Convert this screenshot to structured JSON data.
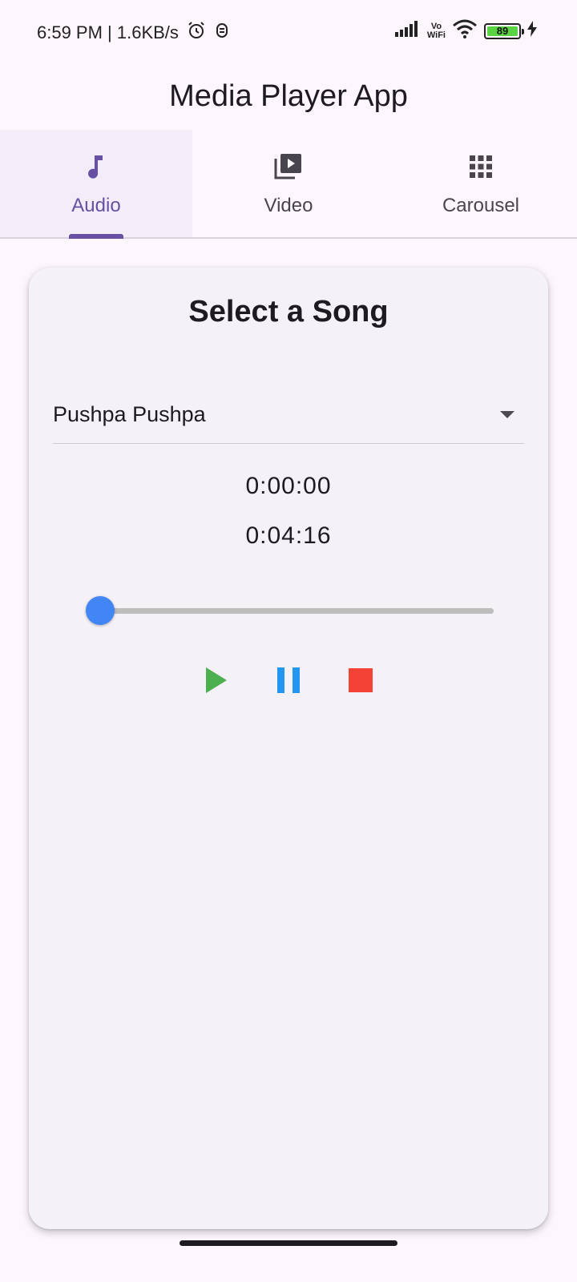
{
  "status_bar": {
    "time_speed": "6:59 PM | 1.6KB/s",
    "vowifi_top": "Vo",
    "vowifi_bottom": "WiFi",
    "battery_level": "89"
  },
  "app_bar": {
    "title": "Media Player App"
  },
  "tabs": [
    {
      "label": "Audio",
      "icon": "music-note-icon",
      "active": true
    },
    {
      "label": "Video",
      "icon": "video-library-icon",
      "active": false
    },
    {
      "label": "Carousel",
      "icon": "apps-grid-icon",
      "active": false
    }
  ],
  "card": {
    "title": "Select a Song",
    "dropdown": {
      "selected": "Pushpa Pushpa"
    },
    "current_time": "0:00:00",
    "total_time": "0:04:16",
    "slider_progress": 0
  },
  "colors": {
    "accent": "#6750a4",
    "play": "#4caf50",
    "pause": "#2196f3",
    "stop": "#f44336",
    "slider_thumb": "#4285f4"
  }
}
